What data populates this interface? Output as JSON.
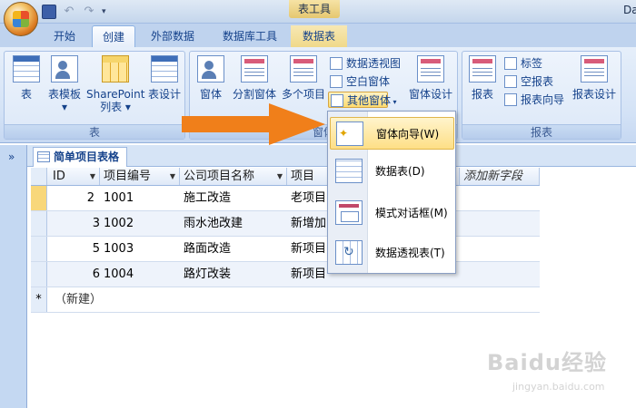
{
  "window": {
    "title": "表工具",
    "title_right": "Da"
  },
  "quick_access": {
    "icons": [
      "save-icon",
      "undo-icon",
      "redo-icon",
      "customize-icon"
    ]
  },
  "tabs": [
    {
      "label": "开始"
    },
    {
      "label": "创建",
      "active": true
    },
    {
      "label": "外部数据"
    },
    {
      "label": "数据库工具"
    },
    {
      "label": "数据表"
    }
  ],
  "ribbon": {
    "groups": {
      "table": {
        "label": "表",
        "buttons": [
          "表",
          "表模板",
          "SharePoint",
          "列表",
          "表设计"
        ]
      },
      "forms": {
        "label": "窗体",
        "buttons": [
          "窗体",
          "分割窗体",
          "多个项目"
        ],
        "small_buttons": [
          "数据透视图",
          "空白窗体",
          "其他窗体"
        ],
        "design": "窗体设计"
      },
      "reports": {
        "label": "报表",
        "report": "报表",
        "small_buttons": [
          "标签",
          "空报表",
          "报表向导"
        ],
        "design": "报表设计"
      }
    }
  },
  "nav_pane": {
    "toggle": "»"
  },
  "document": {
    "tab_label": "简单项目表格",
    "columns": [
      "ID",
      "项目编号",
      "公司项目名称",
      "项目",
      "添加新字段"
    ],
    "rows": [
      {
        "id": "2",
        "code": "1001",
        "name": "施工改造",
        "proj": "老项目"
      },
      {
        "id": "3",
        "code": "1002",
        "name": "雨水池改建",
        "proj": "新增加"
      },
      {
        "id": "5",
        "code": "1003",
        "name": "路面改造",
        "proj": "新项目"
      },
      {
        "id": "6",
        "code": "1004",
        "name": "路灯改装",
        "proj": "新项目"
      }
    ],
    "new_row": {
      "marker": "*",
      "label": "（新建）"
    }
  },
  "dropdown_menu": {
    "items": [
      {
        "label": "窗体向导(W)",
        "icon": "form-wizard-icon",
        "active": true
      },
      {
        "label": "数据表(D)",
        "icon": "datasheet-icon"
      },
      {
        "label": "模式对话框(M)",
        "icon": "modal-dialog-icon"
      },
      {
        "label": "数据透视表(T)",
        "icon": "pivot-table-icon"
      }
    ]
  },
  "watermark": {
    "brand": "Baidu经验",
    "url": "jingyan.baidu.com"
  },
  "colors": {
    "arrow": "#f07f1a",
    "ribbon_bg": "#dce8f8",
    "menu_highlight": "#fedf86",
    "text": "#15428b"
  }
}
